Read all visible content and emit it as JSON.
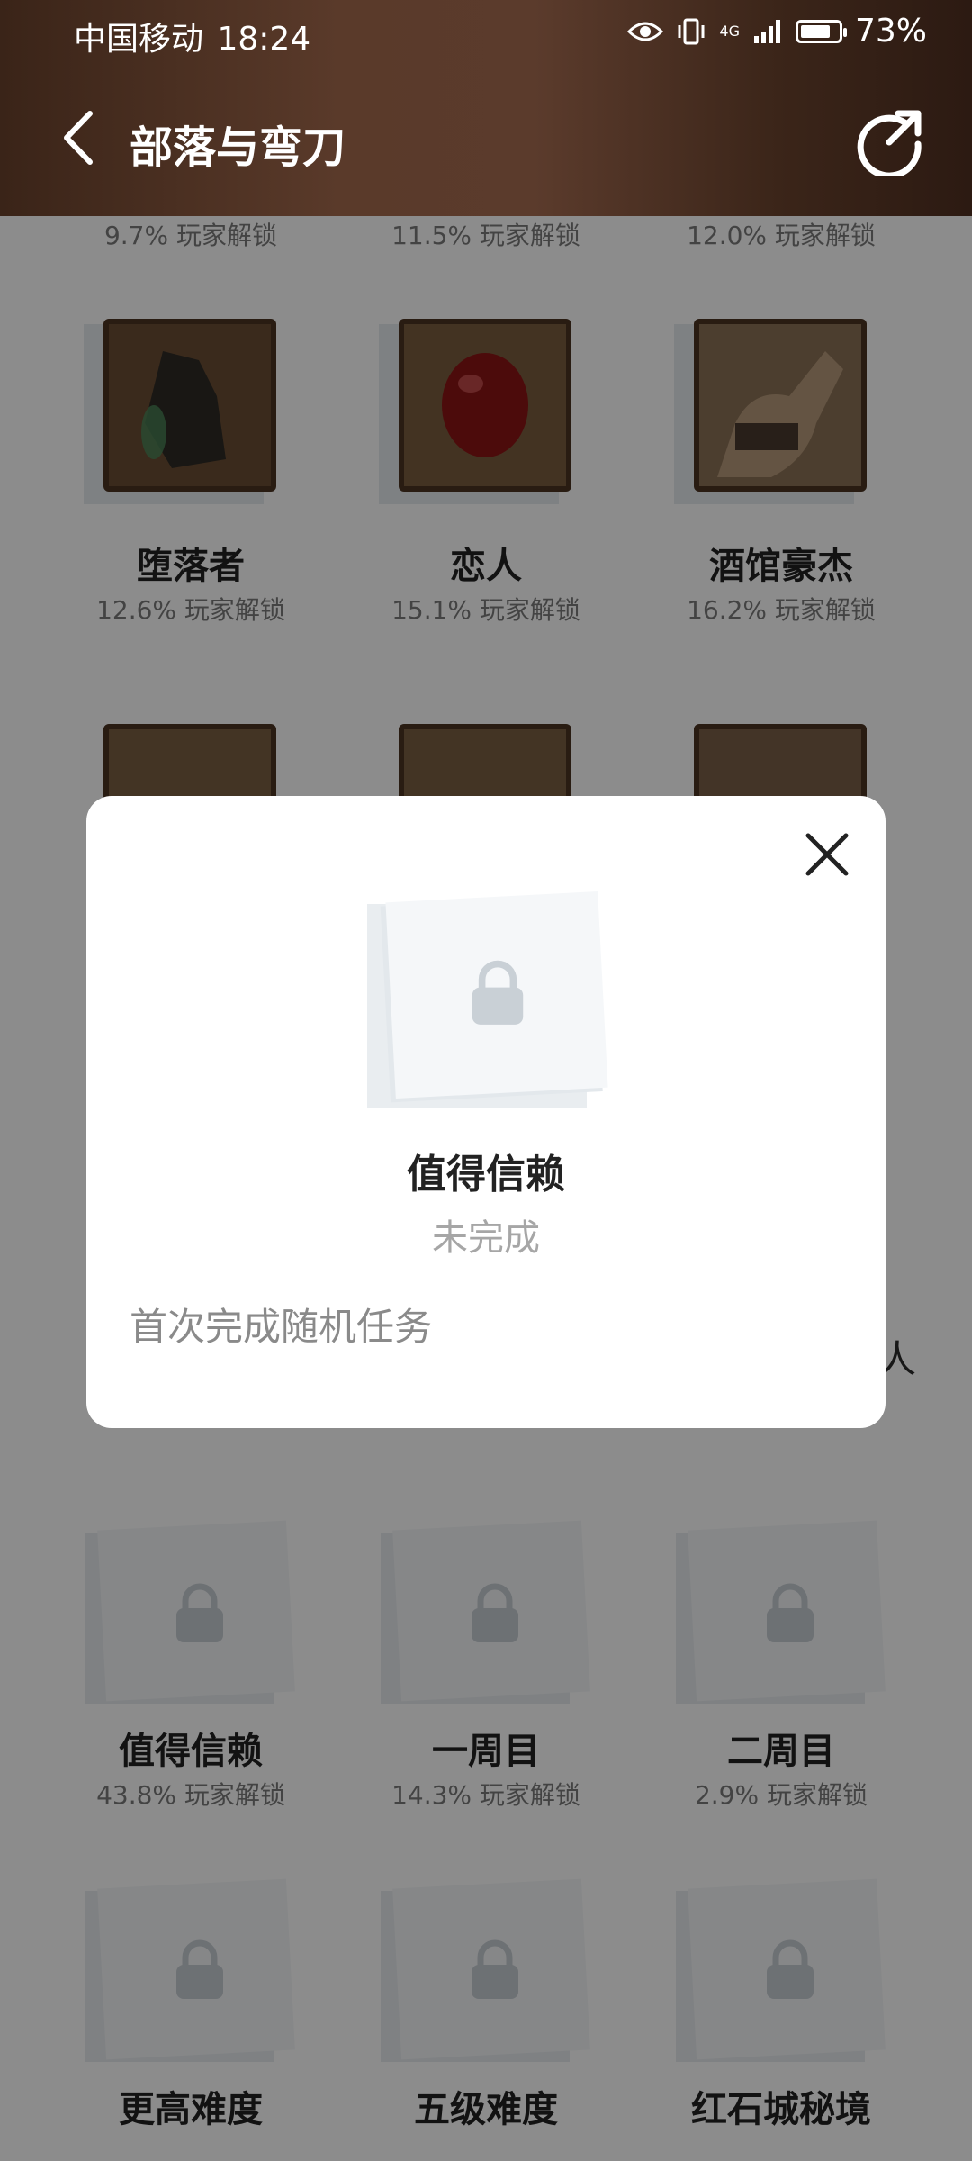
{
  "status_bar": {
    "carrier": "中国移动",
    "time": "18:24",
    "network": "4G",
    "battery": "73%"
  },
  "header": {
    "title": "部落与弯刀"
  },
  "achievements": {
    "top_partial_row": [
      {
        "stat": "9.7% 玩家解锁"
      },
      {
        "stat": "11.5% 玩家解锁"
      },
      {
        "stat": "12.0% 玩家解锁"
      }
    ],
    "row_unlocked": [
      {
        "name": "堕落者",
        "stat": "12.6% 玩家解锁"
      },
      {
        "name": "恋人",
        "stat": "15.1% 玩家解锁"
      },
      {
        "name": "酒馆豪杰",
        "stat": "16.2% 玩家解锁"
      }
    ],
    "row_locked_1": [
      {
        "name": "值得信赖",
        "stat": "43.8% 玩家解锁"
      },
      {
        "name": "一周目",
        "stat": "14.3% 玩家解锁"
      },
      {
        "name": "二周目",
        "stat": "2.9% 玩家解锁"
      }
    ],
    "row_locked_2": [
      {
        "name": "更高难度"
      },
      {
        "name": "五级难度"
      },
      {
        "name": "红石城秘境"
      }
    ],
    "partial_visible_name": "人"
  },
  "dialog": {
    "title": "值得信赖",
    "status": "未完成",
    "description": "首次完成随机任务"
  }
}
